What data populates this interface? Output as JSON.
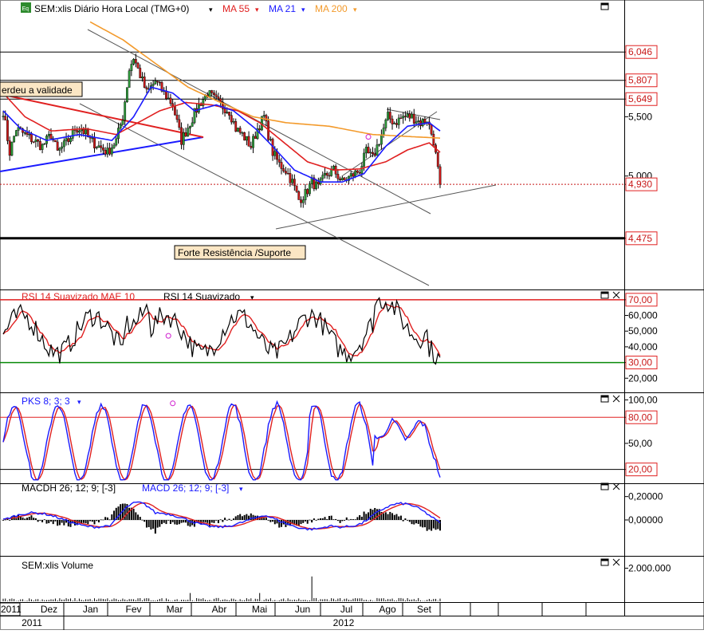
{
  "main": {
    "eq_badge": "Eq",
    "symbol": "SEM:xlis Diário Hora Local (TMG+0)",
    "ma55": "MA 55",
    "ma21": "MA 21",
    "ma200": "MA 200",
    "note_left": "erdeu a validade",
    "note_support": "Forte Resistência /Suporte"
  },
  "rsi": {
    "label1": "RSI 14 Suavizado MAE 10",
    "label2": "RSI 14 Suavizado"
  },
  "pks": {
    "label": "PKS 8; 3; 3"
  },
  "macd": {
    "label1": "MACDH 26; 12; 9; [-3]",
    "label2": "MACD 26; 12; 9; [-3]"
  },
  "volume": {
    "label": "SEM:xlis Volume"
  },
  "colors": {
    "ma55": "#e02020",
    "ma21": "#1a1aff",
    "ma200": "#f39a2b",
    "up": "#2d9a3a",
    "down": "#c81818",
    "support": "#000000"
  },
  "timeline": {
    "months": [
      "2011",
      "Dez",
      "Jan",
      "Fev",
      "Mar",
      "Abr",
      "Mai",
      "Jun",
      "Jul",
      "Ago",
      "Set"
    ],
    "years": [
      "2011",
      "2012"
    ]
  },
  "chart_data": [
    {
      "type": "candlestick",
      "name": "price",
      "ylim": [
        4.05,
        6.35
      ],
      "ticks": [
        6.046,
        5.807,
        5.649,
        5.5,
        5.0,
        4.93,
        4.475
      ],
      "tick_labels": [
        "6,046",
        "5,807",
        "5,649",
        "5,500",
        "5,000",
        "4,930",
        "4,475"
      ],
      "boxed_ticks": [
        "6,046",
        "5,807",
        "5,649",
        "4,930",
        "4,475"
      ],
      "hlines": [
        6.046,
        5.807,
        5.649,
        4.475
      ],
      "last": 4.93,
      "close_key": [
        [
          0,
          5.55
        ],
        [
          3,
          5.2
        ],
        [
          6,
          5.4
        ],
        [
          10,
          5.35
        ],
        [
          14,
          5.3
        ],
        [
          18,
          5.25
        ],
        [
          22,
          5.35
        ],
        [
          25,
          5.2
        ],
        [
          30,
          5.3
        ],
        [
          33,
          5.4
        ],
        [
          36,
          5.4
        ],
        [
          40,
          5.3
        ],
        [
          44,
          5.25
        ],
        [
          48,
          5.2
        ],
        [
          52,
          5.3
        ],
        [
          55,
          5.5
        ],
        [
          58,
          5.9
        ],
        [
          60,
          6.0
        ],
        [
          63,
          5.85
        ],
        [
          66,
          5.7
        ],
        [
          70,
          5.8
        ],
        [
          74,
          5.7
        ],
        [
          78,
          5.6
        ],
        [
          80,
          5.45
        ],
        [
          82,
          5.3
        ],
        [
          86,
          5.45
        ],
        [
          90,
          5.6
        ],
        [
          94,
          5.7
        ],
        [
          97,
          5.65
        ],
        [
          100,
          5.6
        ],
        [
          104,
          5.55
        ],
        [
          107,
          5.4
        ],
        [
          110,
          5.35
        ],
        [
          114,
          5.25
        ],
        [
          117,
          5.4
        ],
        [
          120,
          5.5
        ],
        [
          124,
          5.2
        ],
        [
          127,
          5.1
        ],
        [
          130,
          5.05
        ],
        [
          133,
          4.95
        ],
        [
          136,
          4.8
        ],
        [
          139,
          4.85
        ],
        [
          142,
          4.95
        ],
        [
          145,
          4.9
        ],
        [
          148,
          5.0
        ],
        [
          152,
          5.05
        ],
        [
          156,
          4.95
        ],
        [
          160,
          5.0
        ],
        [
          164,
          5.05
        ],
        [
          167,
          5.2
        ],
        [
          170,
          5.15
        ],
        [
          174,
          5.35
        ],
        [
          177,
          5.5
        ],
        [
          180,
          5.45
        ],
        [
          184,
          5.5
        ],
        [
          188,
          5.5
        ],
        [
          192,
          5.45
        ],
        [
          195,
          5.48
        ],
        [
          198,
          5.3
        ],
        [
          200,
          5.05
        ],
        [
          201,
          4.93
        ]
      ],
      "ma21_key": [
        [
          0,
          5.55
        ],
        [
          8,
          5.4
        ],
        [
          20,
          5.3
        ],
        [
          35,
          5.35
        ],
        [
          50,
          5.3
        ],
        [
          60,
          5.5
        ],
        [
          68,
          5.75
        ],
        [
          78,
          5.7
        ],
        [
          88,
          5.55
        ],
        [
          98,
          5.6
        ],
        [
          106,
          5.55
        ],
        [
          116,
          5.4
        ],
        [
          124,
          5.25
        ],
        [
          134,
          5.05
        ],
        [
          146,
          4.95
        ],
        [
          156,
          4.95
        ],
        [
          166,
          5.02
        ],
        [
          176,
          5.25
        ],
        [
          186,
          5.42
        ],
        [
          196,
          5.45
        ],
        [
          201,
          5.38
        ]
      ],
      "ma55_key": [
        [
          0,
          5.7
        ],
        [
          10,
          5.5
        ],
        [
          22,
          5.38
        ],
        [
          38,
          5.4
        ],
        [
          52,
          5.35
        ],
        [
          62,
          5.45
        ],
        [
          72,
          5.55
        ],
        [
          84,
          5.62
        ],
        [
          96,
          5.6
        ],
        [
          108,
          5.55
        ],
        [
          118,
          5.45
        ],
        [
          128,
          5.3
        ],
        [
          140,
          5.12
        ],
        [
          152,
          5.05
        ],
        [
          164,
          5.06
        ],
        [
          176,
          5.12
        ],
        [
          186,
          5.22
        ],
        [
          196,
          5.28
        ],
        [
          201,
          5.2
        ]
      ],
      "ma200_key": [
        [
          40,
          6.3
        ],
        [
          55,
          6.15
        ],
        [
          70,
          5.95
        ],
        [
          85,
          5.75
        ],
        [
          100,
          5.62
        ],
        [
          115,
          5.5
        ],
        [
          130,
          5.45
        ],
        [
          150,
          5.42
        ],
        [
          170,
          5.35
        ],
        [
          190,
          5.33
        ],
        [
          201,
          5.32
        ]
      ]
    },
    {
      "type": "line",
      "name": "RSI 14 Suavizado",
      "ylim": [
        12,
        75
      ],
      "ticks": [
        70,
        60,
        50,
        40,
        30,
        20
      ],
      "tick_labels": [
        "70,00",
        "60,000",
        "50,000",
        "40,000",
        "30,00",
        "20,000"
      ],
      "boxed_ticks": [
        "70,00",
        "30,00"
      ],
      "levels": [
        70,
        30
      ]
    },
    {
      "type": "line",
      "name": "PKS 8; 3; 3",
      "ylim": [
        5,
        105
      ],
      "ticks": [
        100,
        80,
        50,
        20
      ],
      "tick_labels": [
        "100,00",
        "80,00",
        "50,00",
        "20,00"
      ],
      "boxed_ticks": [
        "80,00",
        "20,00"
      ],
      "levels": [
        80,
        20
      ]
    },
    {
      "type": "bar+line",
      "name": "MACD 26; 12; 9; [-3]",
      "ylim": [
        -0.3,
        0.3
      ],
      "ticks": [
        0.2,
        0.0
      ],
      "tick_labels": [
        "0,20000",
        "0,00000"
      ]
    },
    {
      "type": "bar",
      "name": "SEM:xlis Volume",
      "ylim": [
        0,
        2600000
      ],
      "ticks": [
        2000000
      ],
      "tick_labels": [
        "2.000.000"
      ],
      "spike": [
        142,
        1500000
      ]
    }
  ]
}
